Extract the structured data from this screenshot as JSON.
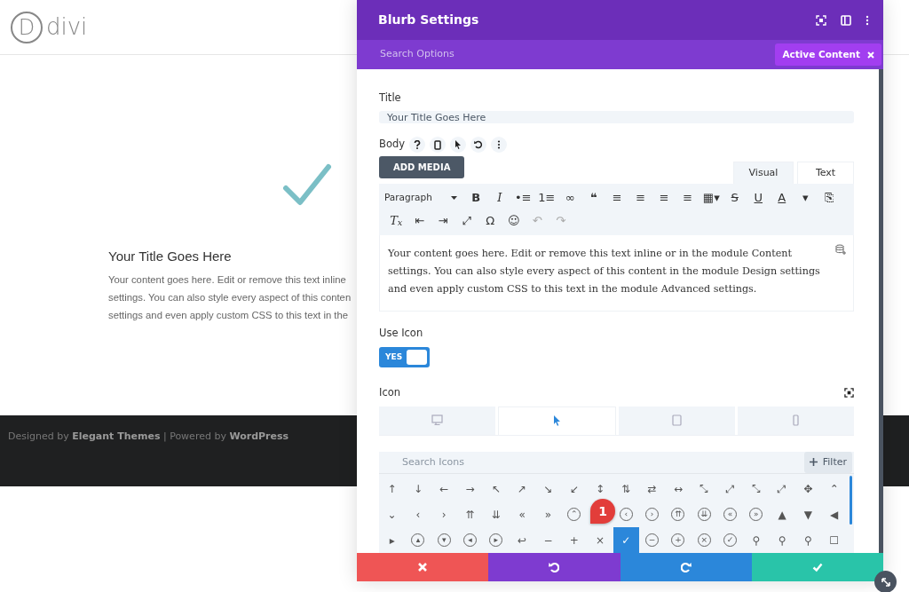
{
  "site": {
    "logo_mark": "D",
    "logo_text": "divi"
  },
  "blurb": {
    "title": "Your Title Goes Here",
    "lines": [
      "Your content goes here. Edit or remove this text inline",
      "settings. You can also style every aspect of this conten",
      "settings and even apply custom CSS to this text in the"
    ]
  },
  "footer": {
    "text": "Designed by **Elegant Themes** | Powered by **WordPress**"
  },
  "modal": {
    "title": "Blurb Settings",
    "search_placeholder": "Search Options",
    "active_filter": "Active Content",
    "title_label": "Title",
    "title_value": "Your Title Goes Here",
    "body_label": "Body",
    "add_media": "ADD MEDIA",
    "editor_tabs": [
      {
        "label": "Visual",
        "selected": true
      },
      {
        "label": "Text",
        "selected": false
      }
    ],
    "format_select": "Paragraph",
    "toolbar_rows": [
      [
        {
          "glyph": "B",
          "kind": "bold"
        },
        {
          "glyph": "I",
          "kind": "italic"
        },
        {
          "glyph": "•≡",
          "kind": "plain"
        },
        {
          "glyph": "1≡",
          "kind": "plain"
        },
        {
          "glyph": "∞",
          "kind": "plain"
        },
        {
          "glyph": "❝",
          "kind": "bold"
        },
        {
          "glyph": "≡",
          "kind": "plain"
        },
        {
          "glyph": "≡",
          "kind": "plain"
        },
        {
          "glyph": "≡",
          "kind": "plain"
        },
        {
          "glyph": "≡",
          "kind": "plain"
        },
        {
          "glyph": "▦▾",
          "kind": "plain"
        },
        {
          "glyph": "S",
          "kind": "strike"
        },
        {
          "glyph": "U",
          "kind": "underline"
        },
        {
          "glyph": "A",
          "kind": "underline"
        },
        {
          "glyph": "▾",
          "kind": "plain"
        },
        {
          "glyph": "⎘",
          "kind": "plain"
        }
      ],
      [
        {
          "glyph": "T$_{x}$",
          "kind": "italic"
        },
        {
          "glyph": "⇤",
          "kind": "plain"
        },
        {
          "glyph": "⇥",
          "kind": "plain"
        },
        {
          "glyph": "⤢",
          "kind": "plain"
        },
        {
          "glyph": "Ω",
          "kind": "plain"
        },
        {
          "glyph": "☺",
          "kind": "plain"
        },
        {
          "glyph": "↶",
          "kind": "muted"
        },
        {
          "glyph": "↷",
          "kind": "muted"
        }
      ]
    ],
    "body_text": "Your content goes here. Edit or remove this text inline or in the module Content settings. You can also style every aspect of this content in the module Design settings and even apply custom CSS to this text in the module Advanced settings.",
    "use_icon": {
      "label": "Use Icon",
      "on": true,
      "text": "YES"
    },
    "icon_label": "Icon",
    "device_tabs": [
      {
        "kind": "desktop",
        "selected": false
      },
      {
        "kind": "hover",
        "selected": true
      },
      {
        "kind": "tablet",
        "selected": false
      },
      {
        "kind": "phone",
        "selected": false
      }
    ],
    "icon_search_placeholder": "Search Icons",
    "filter": "Filter",
    "icon_rows": [
      [
        {
          "glyph": "↑",
          "kind": "plain",
          "selected": false
        },
        {
          "glyph": "↓",
          "kind": "plain",
          "selected": false
        },
        {
          "glyph": "←",
          "kind": "plain",
          "selected": false
        },
        {
          "glyph": "→",
          "kind": "plain",
          "selected": false
        },
        {
          "glyph": "↖",
          "kind": "plain",
          "selected": false
        },
        {
          "glyph": "↗",
          "kind": "plain",
          "selected": false
        },
        {
          "glyph": "↘",
          "kind": "plain",
          "selected": false
        },
        {
          "glyph": "↙",
          "kind": "plain",
          "selected": false
        },
        {
          "glyph": "↕",
          "kind": "plain",
          "selected": false
        },
        {
          "glyph": "⇅",
          "kind": "plain",
          "selected": false
        },
        {
          "glyph": "⇄",
          "kind": "plain",
          "selected": false
        },
        {
          "glyph": "↔",
          "kind": "plain",
          "selected": false
        },
        {
          "glyph": "⤡",
          "kind": "plain",
          "selected": false
        },
        {
          "glyph": "⤢",
          "kind": "plain",
          "selected": false
        },
        {
          "glyph": "⤡",
          "kind": "plain",
          "selected": false
        },
        {
          "glyph": "⤢",
          "kind": "plain",
          "selected": false
        },
        {
          "glyph": "✥",
          "kind": "plain",
          "selected": false
        },
        {
          "glyph": "⌃",
          "kind": "plain",
          "selected": false
        }
      ],
      [
        {
          "glyph": "⌄",
          "kind": "plain",
          "selected": false
        },
        {
          "glyph": "‹",
          "kind": "plain",
          "selected": false
        },
        {
          "glyph": "›",
          "kind": "plain",
          "selected": false
        },
        {
          "glyph": "⇈",
          "kind": "plain",
          "selected": false
        },
        {
          "glyph": "⇊",
          "kind": "plain",
          "selected": false
        },
        {
          "glyph": "«",
          "kind": "plain",
          "selected": false
        },
        {
          "glyph": "»",
          "kind": "plain",
          "selected": false
        },
        {
          "glyph": "⌃",
          "kind": "circled",
          "selected": false
        },
        {
          "kind": "gap"
        },
        {
          "glyph": "‹",
          "kind": "circled",
          "selected": false
        },
        {
          "glyph": "›",
          "kind": "circled",
          "selected": false
        },
        {
          "glyph": "⇈",
          "kind": "circled",
          "selected": false
        },
        {
          "glyph": "⇊",
          "kind": "circled",
          "selected": false
        },
        {
          "glyph": "«",
          "kind": "circled",
          "selected": false
        },
        {
          "glyph": "»",
          "kind": "circled",
          "selected": false
        },
        {
          "glyph": "▲",
          "kind": "plain",
          "selected": false
        },
        {
          "glyph": "▼",
          "kind": "plain",
          "selected": false
        },
        {
          "glyph": "◀",
          "kind": "plain",
          "selected": false
        }
      ],
      [
        {
          "glyph": "▸",
          "kind": "plain",
          "selected": false
        },
        {
          "glyph": "▴",
          "kind": "circled",
          "selected": false
        },
        {
          "glyph": "▾",
          "kind": "circled",
          "selected": false
        },
        {
          "glyph": "◂",
          "kind": "circled",
          "selected": false
        },
        {
          "glyph": "▸",
          "kind": "circled",
          "selected": false
        },
        {
          "glyph": "↩",
          "kind": "plain",
          "selected": false
        },
        {
          "glyph": "−",
          "kind": "plain",
          "selected": false
        },
        {
          "glyph": "+",
          "kind": "plain",
          "selected": false
        },
        {
          "glyph": "×",
          "kind": "plain",
          "selected": false
        },
        {
          "glyph": "✓",
          "kind": "plain",
          "selected": true
        },
        {
          "glyph": "−",
          "kind": "circled",
          "selected": false
        },
        {
          "glyph": "+",
          "kind": "circled",
          "selected": false
        },
        {
          "glyph": "×",
          "kind": "circled",
          "selected": false
        },
        {
          "glyph": "✓",
          "kind": "circled",
          "selected": false
        },
        {
          "glyph": "⚲",
          "kind": "plain",
          "selected": false
        },
        {
          "glyph": "⚲",
          "kind": "plain",
          "selected": false
        },
        {
          "glyph": "⚲",
          "kind": "plain",
          "selected": false
        },
        {
          "glyph": "☐",
          "kind": "plain",
          "selected": false
        }
      ]
    ],
    "badge": "1",
    "footer_buttons": [
      {
        "kind": "cancel"
      },
      {
        "kind": "undo"
      },
      {
        "kind": "redo"
      },
      {
        "kind": "save"
      }
    ]
  }
}
